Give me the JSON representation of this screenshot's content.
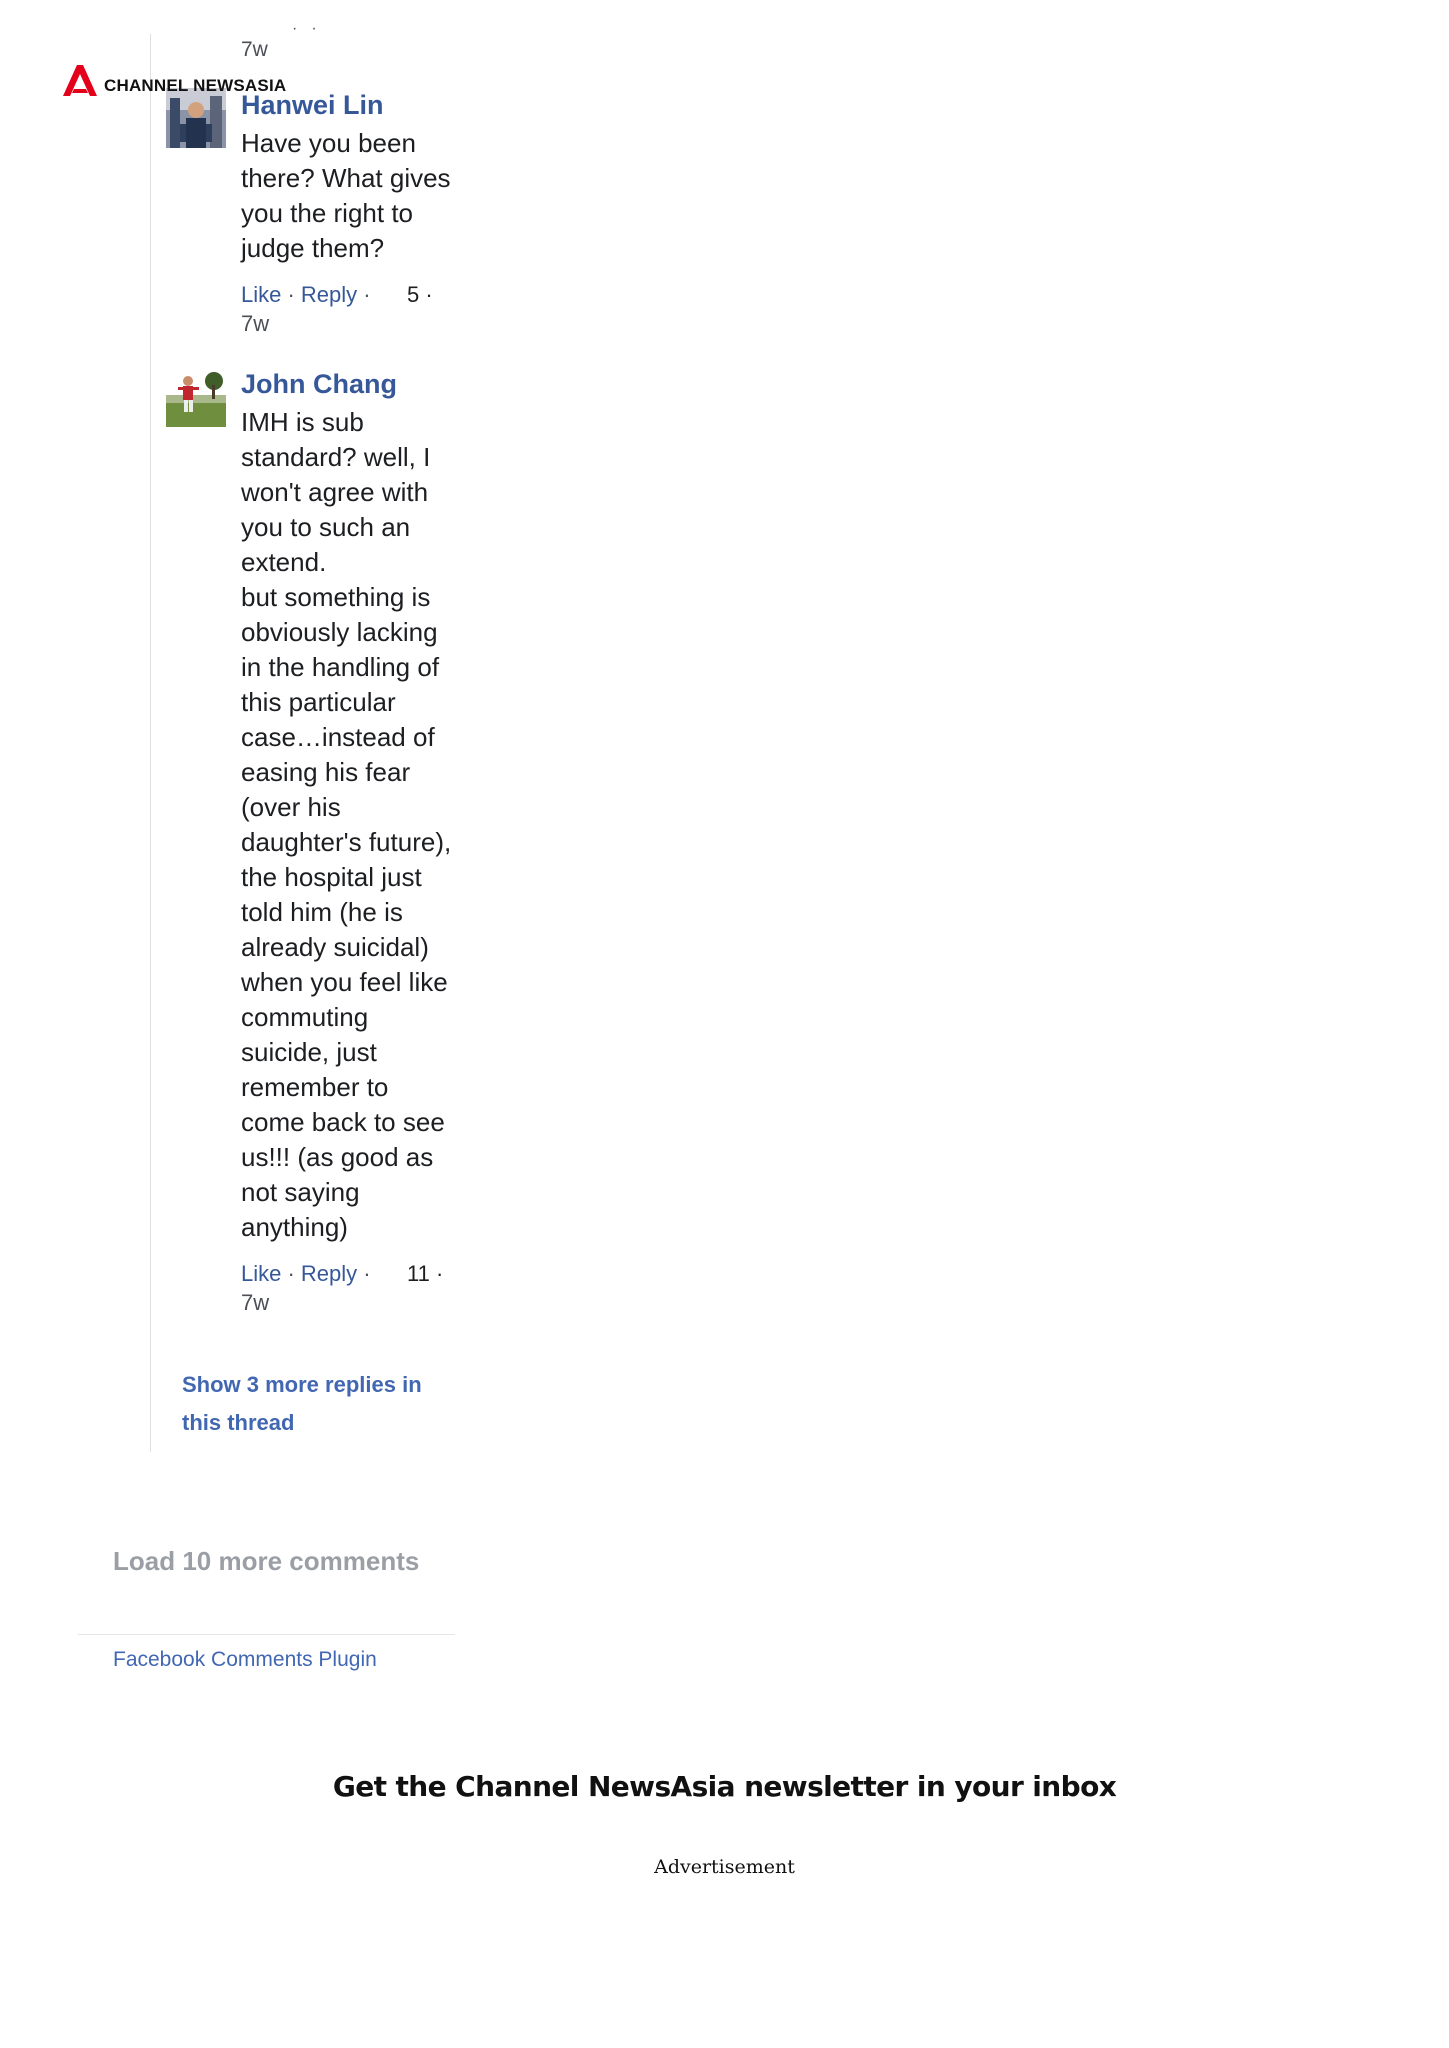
{
  "brand": {
    "logo_text": "CHANNEL NEWSASIA",
    "accent_color": "#e4001b"
  },
  "previous_comment": {
    "time": "7w"
  },
  "comments": [
    {
      "author": "Hanwei Lin",
      "text": "Have you been\nthere? What gives\nyou the right to\njudge them?",
      "like_label": "Like",
      "reply_label": "Reply",
      "likes": "5",
      "time": "7w"
    },
    {
      "author": "John Chang",
      "text": "IMH is sub\nstandard? well, I\nwon't agree with\nyou to such an\nextend.\nbut something is\nobviously lacking\nin the handling of\nthis particular\ncase…instead of\neasing his fear\n(over his\ndaughter's future),\nthe hospital just\ntold him (he is\nalready suicidal)\nwhen you feel like\ncommuting\nsuicide, just\nremember to\ncome back to see\nus!!! (as good as\nnot saying\nanything)",
      "like_label": "Like",
      "reply_label": "Reply",
      "likes": "11",
      "time": "7w"
    }
  ],
  "show_more_replies": "Show 3 more replies in this thread",
  "load_more": "Load 10 more comments",
  "plugin_label": "Facebook Comments Plugin",
  "newsletter_heading": "Get the Channel NewsAsia newsletter in your inbox",
  "advertisement_label": "Advertisement",
  "colors": {
    "link": "#365899",
    "link_bold": "#4267b2",
    "muted": "#9a9ea5",
    "text": "#1c1e21"
  }
}
